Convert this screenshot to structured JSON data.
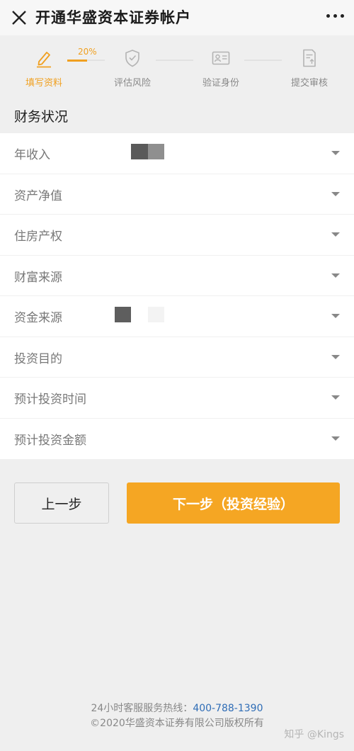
{
  "header": {
    "title": "开通华盛资本证券帐户",
    "close_icon": "close-icon",
    "more_icon": "more-dots-icon"
  },
  "progress": {
    "percent_label": "20%",
    "percent_value": 0.2,
    "accent_color": "#f0a020",
    "steps": [
      {
        "label": "填写资料",
        "icon": "pencil-icon",
        "active": true
      },
      {
        "label": "评估风险",
        "icon": "shield-check-icon",
        "active": false
      },
      {
        "label": "验证身份",
        "icon": "id-card-icon",
        "active": false
      },
      {
        "label": "提交审核",
        "icon": "document-upload-icon",
        "active": false
      }
    ]
  },
  "section": {
    "title": "财务状况"
  },
  "fields": [
    {
      "label": "年收入"
    },
    {
      "label": "资产净值"
    },
    {
      "label": "住房产权"
    },
    {
      "label": "财富来源"
    },
    {
      "label": "资金来源"
    },
    {
      "label": "投资目的"
    },
    {
      "label": "预计投资时间"
    },
    {
      "label": "预计投资金额"
    }
  ],
  "buttons": {
    "prev": "上一步",
    "next": "下一步（投资经验）",
    "next_color": "#f5a623"
  },
  "footer": {
    "hotline_label": "24小时客服服务热线：",
    "hotline_number": "400-788-1390",
    "copyright": "©2020华盛资本证券有限公司版权所有"
  },
  "watermark": "知乎 @Kings"
}
